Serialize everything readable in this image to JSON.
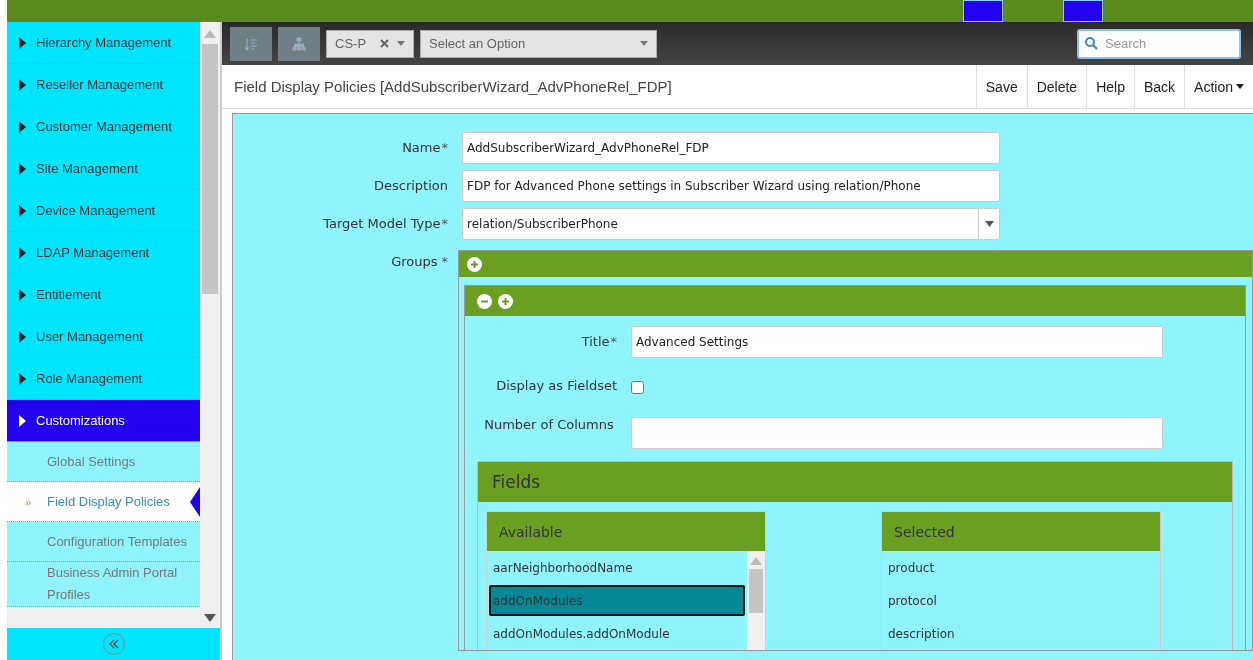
{
  "sidebar": {
    "items": [
      {
        "label": "Hierarchy Management",
        "selected": false
      },
      {
        "label": "Reseller Management",
        "selected": false
      },
      {
        "label": "Customer Management",
        "selected": false
      },
      {
        "label": "Site Management",
        "selected": false
      },
      {
        "label": "Device Management",
        "selected": false
      },
      {
        "label": "LDAP Management",
        "selected": false
      },
      {
        "label": "Entitlement",
        "selected": false
      },
      {
        "label": "User Management",
        "selected": false
      },
      {
        "label": "Role Management",
        "selected": false
      },
      {
        "label": "Customizations",
        "selected": true,
        "children": [
          {
            "label": "Global Settings",
            "selected": false
          },
          {
            "label": "Field Display Policies",
            "selected": true,
            "marker": "»"
          },
          {
            "label": "Configuration Templates",
            "selected": false
          },
          {
            "label": "Business Admin Portal Profiles",
            "selected": false
          }
        ]
      }
    ]
  },
  "toolbar": {
    "hierarchy": "CS-P",
    "option_select": {
      "placeholder": "Select an Option"
    },
    "search": {
      "placeholder": "Search"
    }
  },
  "page": {
    "title": "Field Display Policies [AddSubscriberWizard_AdvPhoneRel_FDP]",
    "actions": [
      "Save",
      "Delete",
      "Help",
      "Back",
      "Action"
    ]
  },
  "form": {
    "fields": [
      {
        "label": "Name",
        "required_mark": "*",
        "value": "AddSubscriberWizard_AdvPhoneRel_FDP",
        "kind": "text"
      },
      {
        "label": "Description",
        "value": "FDP for Advanced Phone settings in Subscriber Wizard using relation/Phone",
        "kind": "text"
      },
      {
        "label": "Target Model Type",
        "required_mark": "*",
        "value": "relation/SubscriberPhone",
        "kind": "select"
      }
    ],
    "groups": {
      "label": "Groups",
      "required_mark": "*",
      "group": {
        "title_label": "Title",
        "title_required_mark": "*",
        "title_value": "Advanced Settings",
        "fieldset_label": "Display as Fieldset",
        "fieldset_checked": false,
        "columns_label": "Number of Columns",
        "fields": {
          "heading": "Fields",
          "available": {
            "heading": "Available",
            "items": [
              {
                "label": "aarNeighborhoodName",
                "selected": false
              },
              {
                "label": "addOnModules",
                "selected": true
              },
              {
                "label": "addOnModules.addOnModule",
                "selected": false
              }
            ]
          },
          "selected": {
            "heading": "Selected",
            "items": [
              "product",
              "protocol",
              "description"
            ]
          }
        }
      }
    }
  }
}
